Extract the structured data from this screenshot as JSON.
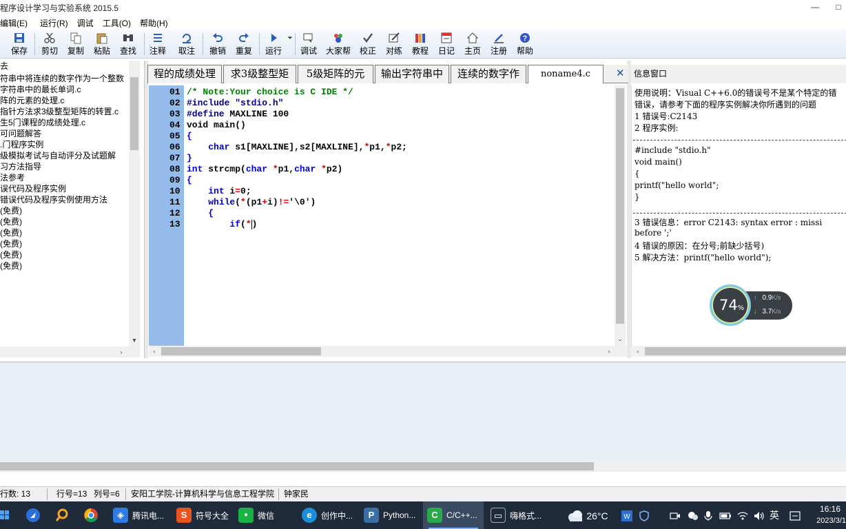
{
  "app": {
    "title": "程序设计学习与实验系统 2015.5",
    "minimize_glyph": "—",
    "restore_glyph": "□"
  },
  "menu": [
    "编辑(E)",
    "运行(R)",
    "调试",
    "工具(O)",
    "帮助(H)"
  ],
  "toolbar": [
    {
      "label": "保存",
      "icon": "save-icon"
    },
    {
      "label": "剪切",
      "icon": "cut-icon"
    },
    {
      "label": "复制",
      "icon": "copy-icon"
    },
    {
      "label": "粘贴",
      "icon": "paste-icon"
    },
    {
      "label": "查找",
      "icon": "find-icon"
    },
    {
      "label": "注释",
      "icon": "comment-icon"
    },
    {
      "label": "取注",
      "icon": "uncomment-icon"
    },
    {
      "label": "撤销",
      "icon": "undo-icon"
    },
    {
      "label": "重复",
      "icon": "redo-icon"
    },
    {
      "label": "运行",
      "icon": "run-icon"
    },
    {
      "label": "调试",
      "icon": "debug-icon"
    },
    {
      "label": "大家帮",
      "icon": "community-icon"
    },
    {
      "label": "校正",
      "icon": "check-icon"
    },
    {
      "label": "对练",
      "icon": "practice-icon"
    },
    {
      "label": "教程",
      "icon": "tutorial-icon"
    },
    {
      "label": "日记",
      "icon": "diary-icon"
    },
    {
      "label": "主页",
      "icon": "home-icon"
    },
    {
      "label": "注册",
      "icon": "register-icon"
    },
    {
      "label": "帮助",
      "icon": "help-icon"
    }
  ],
  "left_panel": {
    "items": [
      "去",
      "符串中将连续的数字作为一个整数",
      "字符串中的最长单词.c",
      "阵的元素的处理.c",
      "指针方法求3级整型矩阵的转置.c",
      "生5门课程的成绩处理.c",
      "可问题解答",
      ".门程序实例",
      "级模拟考试与自动评分及试题解",
      "习方法指导",
      "法参考",
      "误代码及程序实例",
      "错误代码及程序实例使用方法",
      "(免费)",
      "(免费)",
      "(免费)",
      "(免费)",
      "(免费)",
      "(免费)"
    ]
  },
  "tabs": [
    {
      "label": "程的成绩处理",
      "active": false
    },
    {
      "label": "求3级整型矩",
      "active": false
    },
    {
      "label": "5级矩阵的元",
      "active": false
    },
    {
      "label": "输出字符串中",
      "active": false
    },
    {
      "label": "连续的数字作",
      "active": false
    },
    {
      "label": "noname4.c",
      "active": true
    }
  ],
  "tab_close": "✕",
  "editor": {
    "lines": [
      {
        "n": "01",
        "parts": [
          {
            "t": "/* Note:Your choice is C IDE */",
            "c": "cm"
          }
        ]
      },
      {
        "n": "02",
        "parts": [
          {
            "t": "#include \"stdio.h\"",
            "c": "pp"
          }
        ]
      },
      {
        "n": "03",
        "parts": [
          {
            "t": "#define ",
            "c": "pp"
          },
          {
            "t": "MAXLINE 100",
            "c": "tx"
          }
        ]
      },
      {
        "n": "04",
        "parts": [
          {
            "t": "void main()",
            "c": "tx"
          }
        ]
      },
      {
        "n": "05",
        "parts": [
          {
            "t": "{",
            "c": "kw"
          }
        ]
      },
      {
        "n": "06",
        "parts": [
          {
            "t": "    ",
            "c": "tx"
          },
          {
            "t": "char",
            "c": "kw"
          },
          {
            "t": " s1[MAXLINE],s2[MAXLINE],",
            "c": "tx"
          },
          {
            "t": "*",
            "c": "op"
          },
          {
            "t": "p1,",
            "c": "tx"
          },
          {
            "t": "*",
            "c": "op"
          },
          {
            "t": "p2;",
            "c": "tx"
          }
        ]
      },
      {
        "n": "07",
        "parts": [
          {
            "t": "}",
            "c": "kw"
          }
        ]
      },
      {
        "n": "08",
        "parts": [
          {
            "t": "int",
            "c": "kw"
          },
          {
            "t": " strcmp(",
            "c": "tx"
          },
          {
            "t": "char",
            "c": "kw"
          },
          {
            "t": " ",
            "c": "tx"
          },
          {
            "t": "*",
            "c": "op"
          },
          {
            "t": "p1,",
            "c": "tx"
          },
          {
            "t": "char",
            "c": "kw"
          },
          {
            "t": " ",
            "c": "tx"
          },
          {
            "t": "*",
            "c": "op"
          },
          {
            "t": "p2)",
            "c": "tx"
          }
        ]
      },
      {
        "n": "09",
        "parts": [
          {
            "t": "{",
            "c": "kw"
          }
        ]
      },
      {
        "n": "10",
        "parts": [
          {
            "t": "    ",
            "c": "tx"
          },
          {
            "t": "int",
            "c": "kw"
          },
          {
            "t": " i",
            "c": "tx"
          },
          {
            "t": "=",
            "c": "op"
          },
          {
            "t": "0;",
            "c": "tx"
          }
        ]
      },
      {
        "n": "11",
        "parts": [
          {
            "t": "    ",
            "c": "tx"
          },
          {
            "t": "while",
            "c": "kw"
          },
          {
            "t": "(",
            "c": "tx"
          },
          {
            "t": "*",
            "c": "op"
          },
          {
            "t": "(p1",
            "c": "tx"
          },
          {
            "t": "+",
            "c": "op"
          },
          {
            "t": "i)",
            "c": "tx"
          },
          {
            "t": "!=",
            "c": "op"
          },
          {
            "t": "'\\0')",
            "c": "tx"
          }
        ]
      },
      {
        "n": "12",
        "parts": [
          {
            "t": "    ",
            "c": "tx"
          },
          {
            "t": "{",
            "c": "kw"
          }
        ]
      },
      {
        "n": "13",
        "parts": [
          {
            "t": "        ",
            "c": "tx"
          },
          {
            "t": "if",
            "c": "kw"
          },
          {
            "t": "(",
            "c": "tx"
          },
          {
            "t": "*",
            "c": "op"
          },
          {
            "t": ")",
            "c": "tx"
          }
        ]
      }
    ]
  },
  "info": {
    "title": "信息窗口",
    "lines": [
      "使用说明：Visual C++6.0的错误号不是某个特定的错",
      "错误，请参考下面的程序实例解决你所遇到的问题",
      "1 错误号:C2143",
      "2 程序实例:",
      "",
      "#include \"stdio.h\"",
      "void main()",
      "{",
      "   printf(\"hello world\";",
      "}",
      "",
      "3 错误信息：error C2143: syntax error : missi",
      "before ';'",
      "4 错误的原因：在分号;前缺少括号)",
      "5 解决方法：printf(\"hello world\");"
    ]
  },
  "speed_widget": {
    "percent": "74",
    "percent_sign": "%",
    "upload": "0.9",
    "download": "3.7",
    "unit": "K/s",
    "up_glyph": "↑",
    "down_glyph": "↓"
  },
  "status_bar": {
    "total_lines": "行数:  13",
    "row": "行号=13",
    "col": "列号=6",
    "school": "安阳工学院-计算机科学与信息工程学院",
    "author": "钟家民"
  },
  "taskbar": {
    "apps": [
      {
        "label": "腾讯电...",
        "icon": "tencent-manager-icon",
        "color": "#2f7be5",
        "glyph": "◈"
      },
      {
        "label": "符号大全",
        "icon": "sogou-icon",
        "color": "#e8531f",
        "glyph": "S"
      },
      {
        "label": "微信",
        "icon": "wechat-icon",
        "color": "#19b343",
        "glyph": "●"
      },
      {
        "label": "创作中...",
        "icon": "edge-icon",
        "color": "#1a8fd8",
        "glyph": "e"
      },
      {
        "label": "Python...",
        "icon": "python-icon",
        "color": "#3a6ea5",
        "glyph": "P"
      },
      {
        "label": "C/C++...",
        "icon": "c-ide-icon",
        "color": "#2aa84a",
        "glyph": "C"
      },
      {
        "label": "嗨格式...",
        "icon": "screen-recorder-icon",
        "color": "#1f2a3a",
        "glyph": "▭"
      }
    ],
    "weather": "26°C",
    "ime": "英",
    "time": "16:16",
    "date": "2023/3/1"
  }
}
